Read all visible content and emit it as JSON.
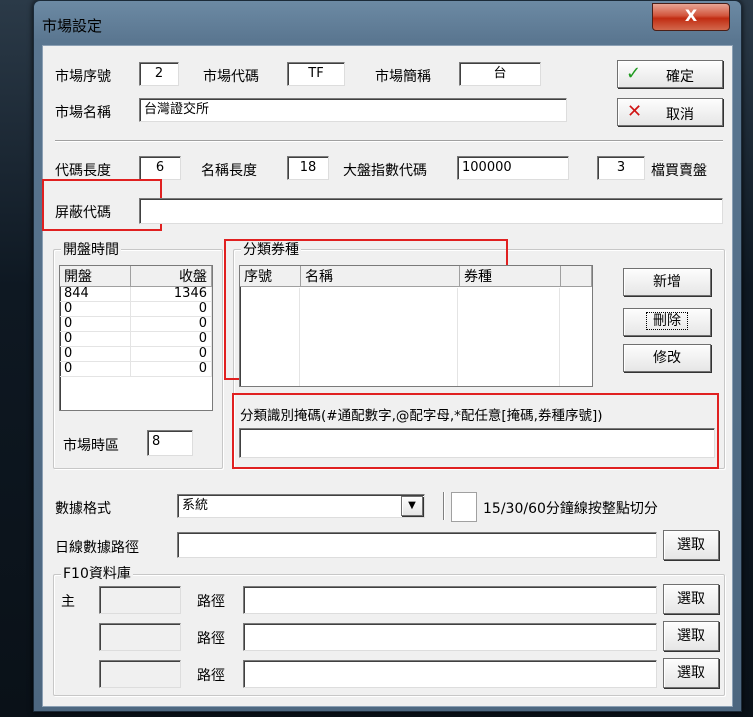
{
  "window": {
    "title": "市場設定",
    "close_label": "X"
  },
  "market": {
    "seq_label": "市場序號",
    "seq_value": "2",
    "code_label": "市場代碼",
    "code_value": "TF",
    "abbr_label": "市場簡稱",
    "abbr_value": "台",
    "name_label": "市場名稱",
    "name_value": "台灣證交所"
  },
  "actions": {
    "ok_label": "確定",
    "cancel_label": "取消"
  },
  "codes": {
    "code_len_label": "代碼長度",
    "code_len_value": "6",
    "name_len_label": "名稱長度",
    "name_len_value": "18",
    "index_label": "大盤指數代碼",
    "index_value": "100000",
    "orderbook_value": "3",
    "orderbook_label": "檔買賣盤",
    "mask_label": "屏蔽代碼",
    "mask_value": ""
  },
  "open_time": {
    "group_label": "開盤時間",
    "columns": [
      "開盤",
      "收盤"
    ],
    "rows": [
      [
        "844",
        "1346"
      ],
      [
        "0",
        "0"
      ],
      [
        "0",
        "0"
      ],
      [
        "0",
        "0"
      ],
      [
        "0",
        "0"
      ],
      [
        "0",
        "0"
      ]
    ],
    "tz_label": "市場時區",
    "tz_value": "8"
  },
  "category": {
    "group_label": "分類券種",
    "columns": [
      "序號",
      "名稱",
      "券種"
    ],
    "add_label": "新增",
    "delete_label": "刪除",
    "edit_label": "修改",
    "mask_label": "分類識別掩碼(#通配數字,@配字母,*配任意[掩碼,券種序號])",
    "mask_value": ""
  },
  "data_format": {
    "label": "數據格式",
    "value": "系統",
    "checkbox_label": "15/30/60分鐘線按整點切分"
  },
  "daily_path": {
    "label": "日線數據路徑",
    "value": "",
    "browse_label": "選取"
  },
  "f10": {
    "group_label": "F10資料庫",
    "main_label": "主",
    "path_label": "路徑",
    "browse_label": "選取",
    "rows": [
      {
        "name": "",
        "path": ""
      },
      {
        "name": "",
        "path": ""
      },
      {
        "name": "",
        "path": ""
      }
    ]
  }
}
